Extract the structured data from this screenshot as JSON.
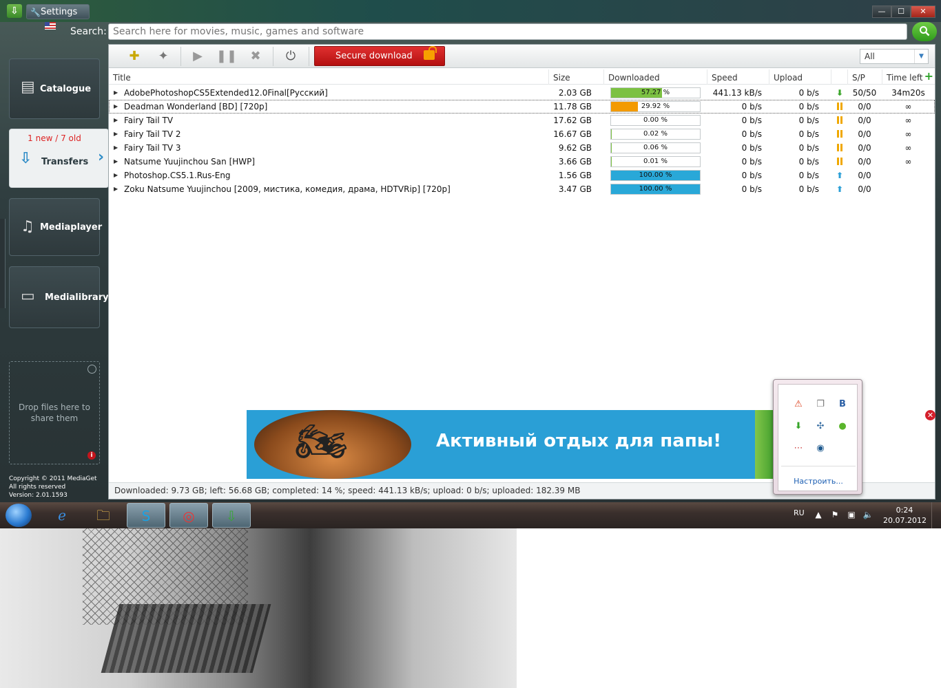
{
  "window": {
    "title": "Settings",
    "buttons": {
      "minimize": "—",
      "maximize": "☐",
      "close": "✕"
    }
  },
  "search": {
    "label": "Search:",
    "placeholder": "Search here for movies, music, games and software"
  },
  "sidebar": {
    "catalogue": "Catalogue",
    "transfers": "Transfers",
    "transfers_counts": "1 new / 7 old",
    "mediaplayer": "Mediaplayer",
    "medialibrary": "Medialibrary",
    "drop_text": "Drop files here to share them",
    "copyright": [
      "Copyright © 2011 MediaGet",
      "All rights reserved",
      "Version: 2.01.1593"
    ]
  },
  "toolbar": {
    "secure_download": "Secure download",
    "filter_value": "All"
  },
  "table": {
    "columns": [
      "Title",
      "Size",
      "Downloaded",
      "Speed",
      "Upload",
      "S/P",
      "Time left"
    ],
    "rows": [
      {
        "title": "AdobePhotoshopCS5Extended12.0Final[Русский]",
        "size": "2.03 GB",
        "progress": 57.27,
        "progress_label": "57.27 %",
        "bar_color": "#7cc142",
        "speed": "441.13 kB/s",
        "upload": "0 b/s",
        "status": "down",
        "sp": "50/50",
        "time_left": "34m20s"
      },
      {
        "title": "Deadman Wonderland [BD] [720p]",
        "size": "11.78 GB",
        "progress": 29.92,
        "progress_label": "29.92 %",
        "bar_color": "#f39a00",
        "speed": "0 b/s",
        "upload": "0 b/s",
        "status": "pause",
        "sp": "0/0",
        "time_left": "∞"
      },
      {
        "title": "Fairy Tail TV",
        "size": "17.62 GB",
        "progress": 0.0,
        "progress_label": "0.00 %",
        "bar_color": "#7cc142",
        "speed": "0 b/s",
        "upload": "0 b/s",
        "status": "pause",
        "sp": "0/0",
        "time_left": "∞"
      },
      {
        "title": "Fairy Tail TV 2",
        "size": "16.67 GB",
        "progress": 0.02,
        "progress_label": "0.02 %",
        "bar_color": "#7cc142",
        "speed": "0 b/s",
        "upload": "0 b/s",
        "status": "pause",
        "sp": "0/0",
        "time_left": "∞"
      },
      {
        "title": "Fairy Tail TV 3",
        "size": "9.62 GB",
        "progress": 0.06,
        "progress_label": "0.06 %",
        "bar_color": "#7cc142",
        "speed": "0 b/s",
        "upload": "0 b/s",
        "status": "pause",
        "sp": "0/0",
        "time_left": "∞"
      },
      {
        "title": "Natsume Yuujinchou San [HWP]",
        "size": "3.66 GB",
        "progress": 0.01,
        "progress_label": "0.01 %",
        "bar_color": "#7cc142",
        "speed": "0 b/s",
        "upload": "0 b/s",
        "status": "pause",
        "sp": "0/0",
        "time_left": "∞"
      },
      {
        "title": "Photoshop.CS5.1.Rus-Eng",
        "size": "1.56 GB",
        "progress": 100.0,
        "progress_label": "100.00 %",
        "bar_color": "#29a8d8",
        "speed": "0 b/s",
        "upload": "0 b/s",
        "status": "up",
        "sp": "0/0",
        "time_left": ""
      },
      {
        "title": "Zoku Natsume Yuujinchou [2009, мистика, комедия, драма, HDTVRip] [720p]",
        "size": "3.47 GB",
        "progress": 100.0,
        "progress_label": "100.00 %",
        "bar_color": "#29a8d8",
        "speed": "0 b/s",
        "upload": "0 b/s",
        "status": "up",
        "sp": "0/0",
        "time_left": ""
      }
    ]
  },
  "ad": {
    "text": "Активный отдых для папы!"
  },
  "statusbar": {
    "text": "Downloaded: 9.73 GB; left: 56.68 GB; completed: 14 %; speed: 441.13 kB/s; upload: 0 b/s; uploaded: 182.39 MB"
  },
  "tray_popup": {
    "link": "Настроить..."
  },
  "taskbar": {
    "lang": "RU",
    "time": "0:24",
    "date": "20.07.2012"
  }
}
